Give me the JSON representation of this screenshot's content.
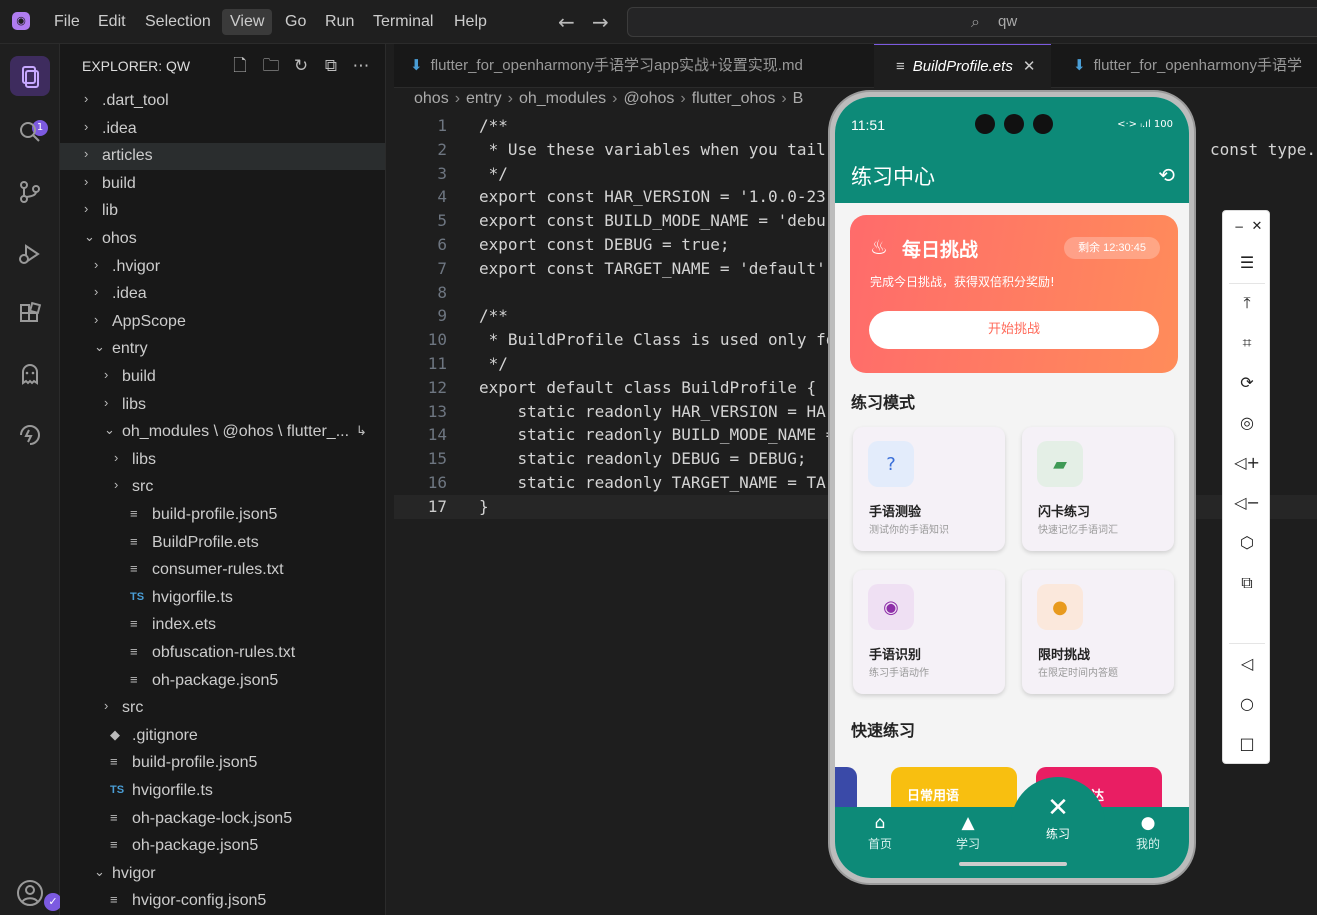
{
  "menubar": {
    "items": [
      "File",
      "Edit",
      "Selection",
      "View",
      "Go",
      "Run",
      "Terminal",
      "Help"
    ],
    "active": "View",
    "search": "qw"
  },
  "activitybar": {
    "badge": "1",
    "account_badge": "✓"
  },
  "sidebar": {
    "title": "EXPLORER: QW",
    "tree": [
      {
        "label": ".dart_tool",
        "type": "folder",
        "open": false
      },
      {
        "label": ".idea",
        "type": "folder",
        "open": false
      },
      {
        "label": "articles",
        "type": "folder",
        "open": false
      },
      {
        "label": "build",
        "type": "folder",
        "open": false
      },
      {
        "label": "lib",
        "type": "folder",
        "open": false
      },
      {
        "label": "ohos",
        "type": "folder",
        "open": true
      },
      {
        "label": ".hvigor",
        "type": "folder",
        "open": false
      },
      {
        "label": ".idea",
        "type": "folder",
        "open": false
      },
      {
        "label": "AppScope",
        "type": "folder",
        "open": false
      },
      {
        "label": "entry",
        "type": "folder",
        "open": true
      },
      {
        "label": "build",
        "type": "folder",
        "open": false
      },
      {
        "label": "libs",
        "type": "folder",
        "open": false
      },
      {
        "label": "oh_modules \\ @ohos \\ flutter_...",
        "type": "folder",
        "open": true
      },
      {
        "label": "libs",
        "type": "folder",
        "open": false
      },
      {
        "label": "src",
        "type": "folder",
        "open": false
      },
      {
        "label": "build-profile.json5",
        "type": "file"
      },
      {
        "label": "BuildProfile.ets",
        "type": "file"
      },
      {
        "label": "consumer-rules.txt",
        "type": "file"
      },
      {
        "label": "hvigorfile.ts",
        "type": "ts"
      },
      {
        "label": "index.ets",
        "type": "file"
      },
      {
        "label": "obfuscation-rules.txt",
        "type": "file"
      },
      {
        "label": "oh-package.json5",
        "type": "file"
      },
      {
        "label": "src",
        "type": "folder",
        "open": false
      },
      {
        "label": ".gitignore",
        "type": "git"
      },
      {
        "label": "build-profile.json5",
        "type": "file"
      },
      {
        "label": "hvigorfile.ts",
        "type": "ts"
      },
      {
        "label": "oh-package-lock.json5",
        "type": "file"
      },
      {
        "label": "oh-package.json5",
        "type": "file"
      },
      {
        "label": "hvigor",
        "type": "folder",
        "open": true
      },
      {
        "label": "hvigor-config.json5",
        "type": "file"
      }
    ]
  },
  "tabs": [
    {
      "label": "flutter_for_openharmony手语学习app实战+设置实现.md",
      "active": false
    },
    {
      "label": "BuildProfile.ets",
      "active": true
    },
    {
      "label": "flutter_for_openharmony手语学",
      "active": false
    }
  ],
  "breadcrumb": [
    "ohos",
    "entry",
    "oh_modules",
    "@ohos",
    "flutter_ohos",
    "B"
  ],
  "code": [
    "/**",
    " * Use these variables when you tail",
    " */",
    "export const HAR_VERSION = '1.0.0-23",
    "export const BUILD_MODE_NAME = 'debu",
    "export const DEBUG = true;",
    "export const TARGET_NAME = 'default'",
    "",
    "/**",
    " * BuildProfile Class is used only fo",
    " */",
    "export default class BuildProfile {",
    "    static readonly HAR_VERSION = HA",
    "    static readonly BUILD_MODE_NAME =",
    "    static readonly DEBUG = DEBUG;",
    "    static readonly TARGET_NAME = TA",
    "}"
  ],
  "code_overflow_text": "const type.",
  "current_line": 17,
  "phone": {
    "time": "11:51",
    "status_icons": "<·> ᵢ.ıl 100",
    "appbar_title": "练习中心",
    "challenge": {
      "title": "每日挑战",
      "remaining": "剩余 12:30:45",
      "subtitle": "完成今日挑战，获得双倍积分奖励!",
      "button": "开始挑战"
    },
    "modes_title": "练习模式",
    "cards": [
      {
        "title": "手语测验",
        "sub": "测试你的手语知识",
        "icon": "?",
        "bg": "#e3ecfb",
        "color": "#3a6fd8"
      },
      {
        "title": "闪卡练习",
        "sub": "快速记忆手语词汇",
        "icon": "▰",
        "bg": "#e4efe6",
        "color": "#3f9a56"
      },
      {
        "title": "手语识别",
        "sub": "练习手语动作",
        "icon": "◉",
        "bg": "#efe0f3",
        "color": "#8e2fa8"
      },
      {
        "title": "限时挑战",
        "sub": "在限定时间内答题",
        "icon": "●",
        "bg": "#fbe8dc",
        "color": "#e89a1e"
      }
    ],
    "quick_title": "快速练习",
    "quick": [
      "日常用语",
      "情感表达"
    ],
    "nav": [
      {
        "label": "首页",
        "icon": "⌂"
      },
      {
        "label": "学习",
        "icon": "▲"
      },
      {
        "label": "练习",
        "icon": "✕"
      },
      {
        "label": "我的",
        "icon": "●"
      }
    ],
    "nav_active": "练习"
  }
}
